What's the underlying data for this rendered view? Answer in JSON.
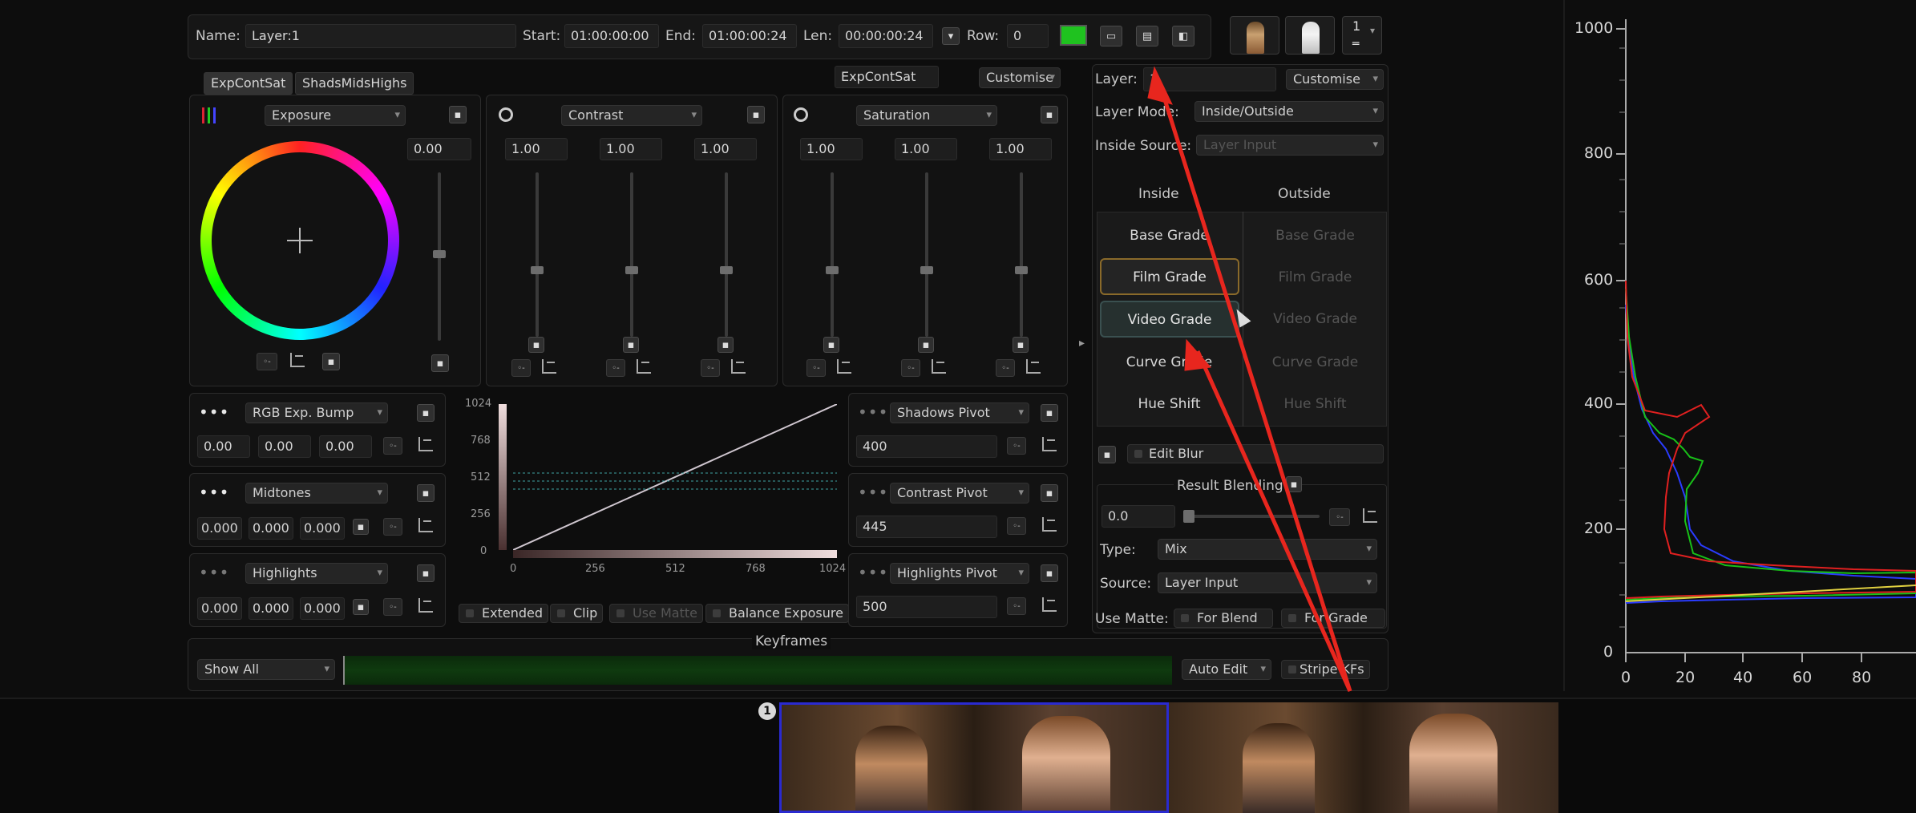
{
  "header": {
    "name_label": "Name:",
    "name_value": "Layer:1",
    "start_label": "Start:",
    "start_value": "01:00:00:00",
    "end_label": "End:",
    "end_value": "01:00:00:24",
    "len_label": "Len:",
    "len_value": "00:00:00:24",
    "row_label": "Row:",
    "row_value": "0",
    "layer_spin": "1",
    "swatch_color": "#1fc21f"
  },
  "tabs": [
    "ExpContSat",
    "ShadsMidsHighs"
  ],
  "preset": {
    "name": "ExpContSat",
    "customise": "Customise"
  },
  "exposure": {
    "dropdown": "Exposure",
    "value": "0.00"
  },
  "contrast": {
    "dropdown": "Contrast",
    "values": [
      "1.00",
      "1.00",
      "1.00"
    ]
  },
  "saturation": {
    "dropdown": "Saturation",
    "values": [
      "1.00",
      "1.00",
      "1.00"
    ]
  },
  "rgb_bump": {
    "dropdown": "RGB Exp. Bump",
    "values": [
      "0.00",
      "0.00",
      "0.00"
    ]
  },
  "midtones": {
    "dropdown": "Midtones",
    "values": [
      "0.000",
      "0.000",
      "0.000"
    ]
  },
  "highlights": {
    "dropdown": "Highlights",
    "values": [
      "0.000",
      "0.000",
      "0.000"
    ]
  },
  "curve": {
    "y_ticks": [
      "1024",
      "768",
      "512",
      "256",
      "0"
    ],
    "x_ticks": [
      "0",
      "256",
      "512",
      "768",
      "1024"
    ],
    "checks": [
      "Extended",
      "Clip",
      "Use Matte",
      "Balance Exposure"
    ]
  },
  "pivots": [
    {
      "label": "Shadows Pivot",
      "value": "400"
    },
    {
      "label": "Contrast Pivot",
      "value": "445"
    },
    {
      "label": "Highlights Pivot",
      "value": "500"
    }
  ],
  "layer_panel": {
    "layer_label": "Layer:",
    "layer_value": "1",
    "customise": "Customise",
    "mode_label": "Layer Mode:",
    "mode_value": "Inside/Outside",
    "source_label": "Inside Source:",
    "source_value": "Layer Input",
    "inside_header": "Inside",
    "outside_header": "Outside",
    "grades": [
      "Base Grade",
      "Film Grade",
      "Video Grade",
      "Curve Grade",
      "Hue Shift"
    ],
    "edit_blur": "Edit Blur",
    "result_blending": "Result Blending",
    "blend_value": "0.0",
    "type_label": "Type:",
    "type_value": "Mix",
    "source2_label": "Source:",
    "source2_value": "Layer Input",
    "use_matte_label": "Use Matte:",
    "for_blend": "For Blend",
    "for_grade": "For Grade"
  },
  "keyframes": {
    "title": "Keyframes",
    "show": "Show All",
    "auto_edit": "Auto Edit",
    "stripe": "Stripe KFs"
  },
  "histogram": {
    "y_ticks": [
      "1000",
      "800",
      "600",
      "400",
      "200",
      "0"
    ],
    "x_ticks": [
      "0",
      "20",
      "40",
      "60",
      "80"
    ]
  },
  "timeline": {
    "clip_badge": "1"
  },
  "colors": {
    "red": "#e02020",
    "green": "#18c018",
    "blue": "#2a3cff",
    "annotation": "#e8261e"
  }
}
